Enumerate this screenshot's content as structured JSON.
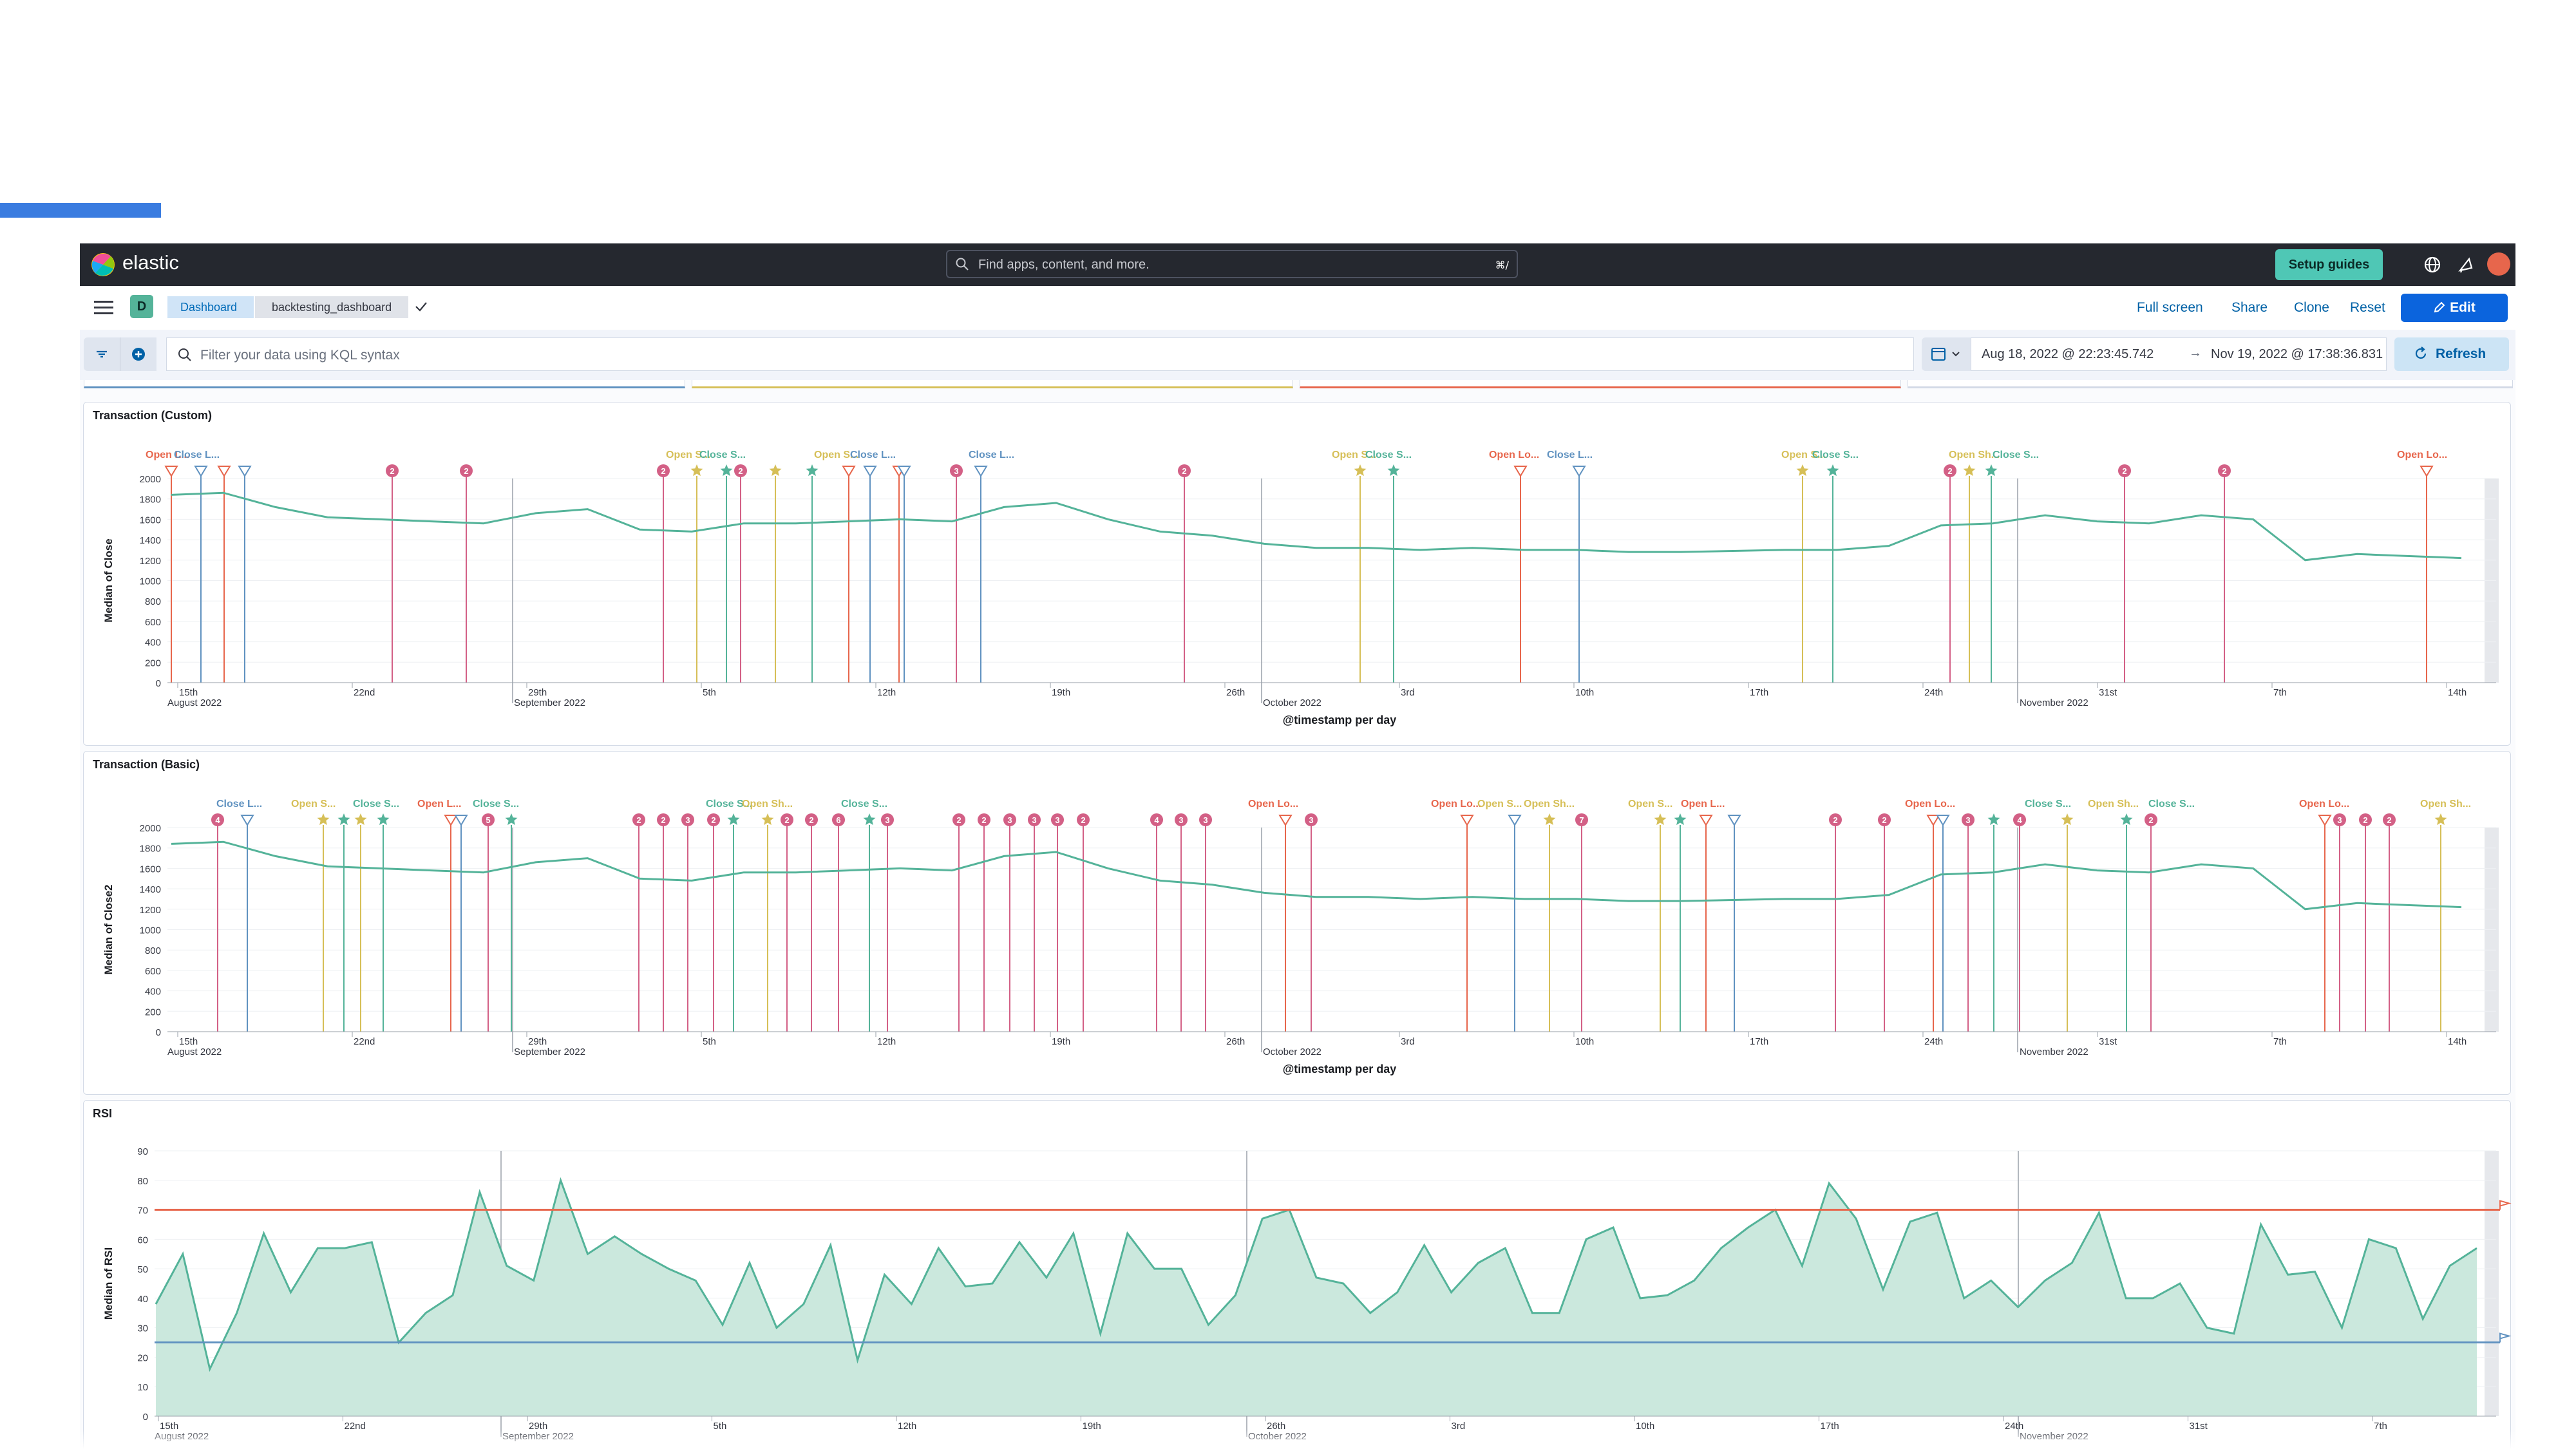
{
  "header": {
    "brand": "elastic",
    "search_placeholder": "Find apps, content, and more.",
    "search_shortcut": "⌘/",
    "setup_label": "Setup guides",
    "icons": [
      "globe-icon",
      "newsfeed-icon",
      "user-avatar"
    ]
  },
  "breadcrumbs": {
    "dashboard": "Dashboard",
    "current": "backtesting_dashboard"
  },
  "actions": {
    "full_screen": "Full screen",
    "share": "Share",
    "clone": "Clone",
    "reset": "Reset",
    "edit": "Edit"
  },
  "query": {
    "placeholder": "Filter your data using KQL syntax",
    "date_start": "Aug 18, 2022 @ 22:23:45.742",
    "date_end": "Nov 19, 2022 @ 17:38:36.831",
    "refresh": "Refresh"
  },
  "colors": {
    "line": "#54b399",
    "fill": "#cbe8dd",
    "open_long": "#e7664c",
    "close_long": "#6092c0",
    "open_short": "#d6bf57",
    "close_short": "#54b399",
    "badge": "#d36086",
    "threshold_high": "#e7664c",
    "threshold_low": "#6092c0"
  },
  "x_ticks": [
    "15th",
    "22nd",
    "29th",
    "5th",
    "12th",
    "19th",
    "26th",
    "3rd",
    "10th",
    "17th",
    "24th",
    "31st",
    "7th",
    "14th"
  ],
  "x_months": [
    "August 2022",
    "September 2022",
    "October 2022",
    "November 2022"
  ],
  "x_axis_title": "@timestamp per day",
  "panels": [
    {
      "title": "Transaction (Custom)",
      "chart_data": {
        "type": "line",
        "title": "Transaction (Custom)",
        "xlabel": "@timestamp per day",
        "ylabel": "Median of Close",
        "ylim": [
          0,
          2000
        ],
        "y_ticks": [
          0,
          200,
          400,
          600,
          800,
          1000,
          1200,
          1400,
          1600,
          1800,
          2000
        ],
        "x": [
          "Aug 15",
          "Aug 16",
          "Aug 17",
          "Aug 18",
          "Aug 19",
          "Aug 20",
          "Aug 22",
          "Aug 24",
          "Aug 26",
          "Aug 28",
          "Aug 30",
          "Sep 1",
          "Sep 3",
          "Sep 5",
          "Sep 7",
          "Sep 9",
          "Sep 11",
          "Sep 13",
          "Sep 15",
          "Sep 17",
          "Sep 19",
          "Sep 21",
          "Sep 24",
          "Sep 27",
          "Sep 30",
          "Oct 3",
          "Oct 6",
          "Oct 9",
          "Oct 12",
          "Oct 15",
          "Oct 18",
          "Oct 21",
          "Oct 24",
          "Oct 27",
          "Oct 29",
          "Oct 31",
          "Nov 2",
          "Nov 4",
          "Nov 6",
          "Nov 8",
          "Nov 10",
          "Nov 12",
          "Nov 14",
          "Nov 16",
          "Nov 18"
        ],
        "values": [
          1840,
          1860,
          1720,
          1620,
          1600,
          1580,
          1560,
          1660,
          1700,
          1500,
          1480,
          1560,
          1560,
          1580,
          1600,
          1580,
          1720,
          1760,
          1600,
          1480,
          1440,
          1360,
          1320,
          1320,
          1300,
          1320,
          1300,
          1300,
          1280,
          1280,
          1290,
          1300,
          1300,
          1340,
          1540,
          1560,
          1640,
          1580,
          1560,
          1640,
          1600,
          1200,
          1260,
          1240,
          1220
        ],
        "markers": [
          {
            "label": "Open L...",
            "kind": "open_long"
          },
          {
            "label": "Close L...",
            "kind": "close_long"
          },
          {
            "label": "Open S...",
            "kind": "open_short"
          },
          {
            "label": "Close S...",
            "kind": "close_short"
          },
          {
            "label": "Open Lo...",
            "kind": "open_long"
          },
          {
            "label": "Close L...",
            "kind": "close_long"
          },
          {
            "label": "Open Sh...",
            "kind": "open_short"
          },
          {
            "label": "Close S...",
            "kind": "close_short"
          }
        ]
      }
    },
    {
      "title": "Transaction (Basic)",
      "chart_data": {
        "type": "line",
        "title": "Transaction (Basic)",
        "xlabel": "@timestamp per day",
        "ylabel": "Median of Close2",
        "ylim": [
          0,
          2000
        ],
        "y_ticks": [
          0,
          200,
          400,
          600,
          800,
          1000,
          1200,
          1400,
          1600,
          1800,
          2000
        ],
        "values": [
          1840,
          1860,
          1720,
          1620,
          1600,
          1580,
          1560,
          1660,
          1700,
          1500,
          1480,
          1560,
          1560,
          1580,
          1600,
          1580,
          1720,
          1760,
          1600,
          1480,
          1440,
          1360,
          1320,
          1320,
          1300,
          1320,
          1300,
          1300,
          1280,
          1280,
          1290,
          1300,
          1300,
          1340,
          1540,
          1560,
          1640,
          1580,
          1560,
          1640,
          1600,
          1200,
          1260,
          1240,
          1220
        ],
        "markers": [
          {
            "label": "Close L...",
            "kind": "close_long"
          },
          {
            "label": "Open S...",
            "kind": "open_short"
          },
          {
            "label": "Close S...",
            "kind": "close_short"
          },
          {
            "label": "Open L...",
            "kind": "open_long"
          },
          {
            "label": "Open Sh...",
            "kind": "open_short"
          },
          {
            "label": "Open Lo...",
            "kind": "open_long"
          }
        ]
      }
    },
    {
      "title": "RSI",
      "chart_data": {
        "type": "area",
        "title": "RSI",
        "xlabel": "@timestamp per day",
        "ylabel": "Median of RSI",
        "ylim": [
          0,
          90
        ],
        "y_ticks": [
          0,
          10,
          20,
          30,
          40,
          50,
          60,
          70,
          80,
          90
        ],
        "thresholds": [
          70,
          25
        ],
        "values": [
          38,
          55,
          16,
          35,
          62,
          42,
          57,
          57,
          59,
          25,
          35,
          41,
          76,
          51,
          46,
          80,
          55,
          61,
          55,
          50,
          46,
          31,
          52,
          30,
          38,
          58,
          19,
          48,
          38,
          57,
          44,
          45,
          59,
          47,
          62,
          28,
          62,
          50,
          50,
          31,
          41,
          67,
          70,
          47,
          45,
          35,
          42,
          58,
          42,
          52,
          57,
          35,
          35,
          60,
          64,
          40,
          41,
          46,
          57,
          64,
          70,
          51,
          79,
          67,
          43,
          66,
          69,
          40,
          46,
          37,
          46,
          52,
          69,
          40,
          40,
          45,
          30,
          28,
          65,
          48,
          49,
          30,
          60,
          57,
          33,
          51,
          57
        ]
      }
    }
  ]
}
